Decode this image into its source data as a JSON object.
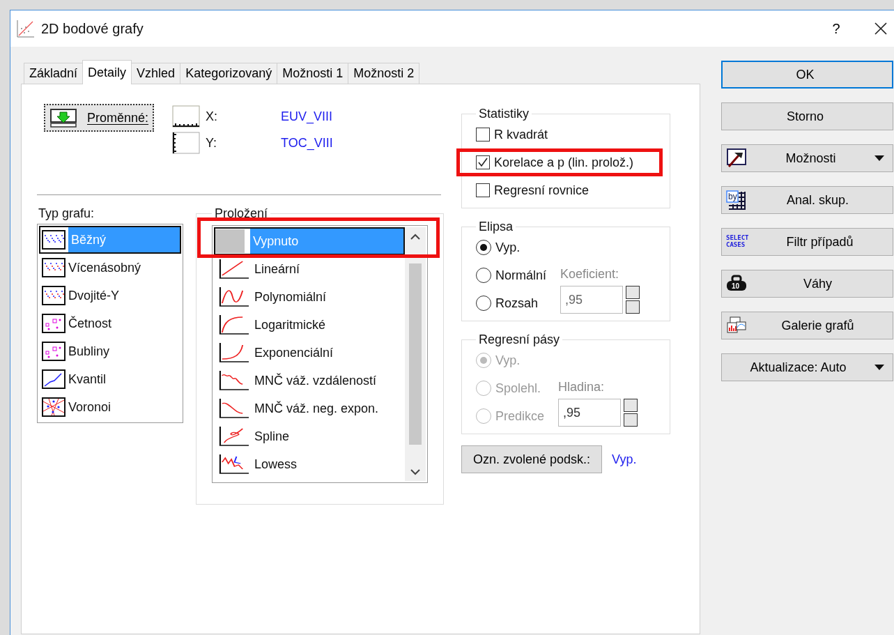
{
  "window": {
    "title": "2D bodové grafy",
    "help": "?"
  },
  "tabs": [
    {
      "label": "Základní",
      "selected": false
    },
    {
      "label": "Detaily",
      "selected": true
    },
    {
      "label": "Vzhled",
      "selected": false
    },
    {
      "label": "Kategorizovaný",
      "selected": false
    },
    {
      "label": "Možnosti 1",
      "selected": false
    },
    {
      "label": "Možnosti 2",
      "selected": false
    }
  ],
  "variables": {
    "button": "Proměnné:",
    "rows": [
      {
        "axis": "X:",
        "value": "EUV_VIII"
      },
      {
        "axis": "Y:",
        "value": "TOC_VIII"
      }
    ]
  },
  "graph_type": {
    "label": "Typ grafu:",
    "items": [
      {
        "label": "Běžný",
        "selected": true
      },
      {
        "label": "Vícenásobný",
        "selected": false
      },
      {
        "label": "Dvojité-Y",
        "selected": false
      },
      {
        "label": "Četnost",
        "selected": false
      },
      {
        "label": "Bubliny",
        "selected": false
      },
      {
        "label": "Kvantil",
        "selected": false
      },
      {
        "label": "Voronoi",
        "selected": false
      }
    ]
  },
  "fit": {
    "label": "Proložení",
    "items": [
      {
        "label": "Vypnuto",
        "selected": true,
        "highlighted": true
      },
      {
        "label": "Lineární",
        "selected": false,
        "highlighted": false
      },
      {
        "label": "Polynomiální",
        "selected": false,
        "highlighted": false
      },
      {
        "label": "Logaritmické",
        "selected": false,
        "highlighted": false
      },
      {
        "label": "Exponenciální",
        "selected": false,
        "highlighted": false
      },
      {
        "label": "MNČ váž. vzdáleností",
        "selected": false,
        "highlighted": false
      },
      {
        "label": "MNČ váž. neg. expon.",
        "selected": false,
        "highlighted": false
      },
      {
        "label": "Spline",
        "selected": false,
        "highlighted": false
      },
      {
        "label": "Lowess",
        "selected": false,
        "highlighted": false
      }
    ]
  },
  "statistics": {
    "label": "Statistiky",
    "items": [
      {
        "label": "R kvadrát",
        "checked": false,
        "highlighted": false
      },
      {
        "label": "Korelace a p (lin. prolož.)",
        "checked": true,
        "highlighted": true
      },
      {
        "label": "Regresní rovnice",
        "checked": false,
        "highlighted": false
      }
    ]
  },
  "ellipse": {
    "label": "Elipsa",
    "disabled": false,
    "options": [
      {
        "label": "Vyp.",
        "selected": true
      },
      {
        "label": "Normální",
        "selected": false
      },
      {
        "label": "Rozsah",
        "selected": false
      }
    ],
    "field": {
      "label": "Koeficient:",
      "value": ",95",
      "disabled": true
    }
  },
  "bands": {
    "label": "Regresní pásy",
    "disabled": true,
    "options": [
      {
        "label": "Vyp.",
        "selected": true
      },
      {
        "label": "Spolehl.",
        "selected": false
      },
      {
        "label": "Predikce",
        "selected": false
      }
    ],
    "field": {
      "label": "Hladina:",
      "value": ",95",
      "disabled": false
    }
  },
  "subset_button": {
    "label": "Ozn. zvolené podsk.:",
    "value": "Vyp."
  },
  "buttons": [
    {
      "label": "OK",
      "kind": "default"
    },
    {
      "label": "Storno",
      "kind": "plain"
    },
    {
      "label": "Možnosti",
      "kind": "icon-menu"
    },
    {
      "label": "Anal. skup.",
      "kind": "icon",
      "icon_text": "by"
    },
    {
      "label": "Filtr případů",
      "kind": "icon",
      "icon_text": "SELECT CASES"
    },
    {
      "label": "Váhy",
      "kind": "icon",
      "icon_text": "10"
    },
    {
      "label": "Galerie grafů",
      "kind": "icon"
    },
    {
      "label": "Aktualizace: Auto",
      "kind": "menu"
    }
  ]
}
